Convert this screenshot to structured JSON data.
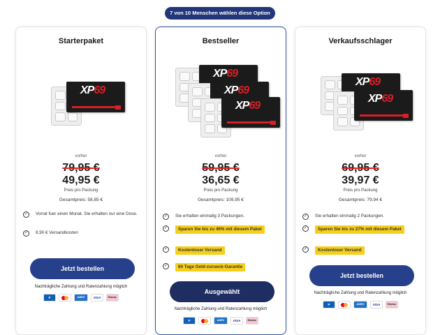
{
  "banner": "7 von 10 Menschen wählen diese Option",
  "cards": [
    {
      "title": "Starterpaket",
      "vorher": "vorher",
      "old_price": "79,95 €",
      "new_price": "49,95 €",
      "per_pack": "Preis pro Packung",
      "total": "Gesamtpreis: 58,85 €",
      "features": [
        {
          "text": "Vorrat fuer einen Monat. Sie erhalten nur eine Dose.",
          "highlight": false
        },
        {
          "text": "8,90 € Versandkosten",
          "highlight": false
        }
      ],
      "button": "Jetzt bestellen",
      "note": "Nachträgliche Zahlung und Ratenzahlung möglich"
    },
    {
      "title": "Bestseller",
      "vorher": "vorher",
      "old_price": "59,95 €",
      "new_price": "36,65 €",
      "per_pack": "Preis pro Packung",
      "total": "Gesamtpreis: 109,95 €",
      "features": [
        {
          "text": "Sie erhalten einmalig 3 Packungen.",
          "highlight": false
        },
        {
          "text": "Sparen Sie bis zu 46% mit diesem Paket",
          "highlight": true
        },
        {
          "text": "Kostenloser Versand",
          "highlight": true
        },
        {
          "text": "60 Tage Geld-zurueck-Garantie",
          "highlight": true
        }
      ],
      "button": "Ausgewählt",
      "note": "Nachträgliche Zahlung und Ratenzahlung möglich"
    },
    {
      "title": "Verkaufsschlager",
      "vorher": "vorher",
      "old_price": "69,95 €",
      "new_price": "39,97 €",
      "per_pack": "Preis pro Packung",
      "total": "Gesamtpreis: 79,94 €",
      "features": [
        {
          "text": "Sie erhalten einmalig 2 Packungen.",
          "highlight": false
        },
        {
          "text": "Sparen Sie bis zu 27% mit diesem Paket",
          "highlight": true
        },
        {
          "text": "Kostenloser Versand",
          "highlight": true
        }
      ],
      "button": "Jetzt bestellen",
      "note": "Nachträgliche Zahlung und Ratenzahlung möglich"
    }
  ],
  "product": {
    "logo_main": "XP",
    "logo_num": "69"
  },
  "payments": [
    "P",
    "",
    "AMEX",
    "VISA",
    "Klarna."
  ],
  "colors": {
    "accent": "#27408b",
    "highlight": "#f5cf1c",
    "strike": "#e02020"
  }
}
